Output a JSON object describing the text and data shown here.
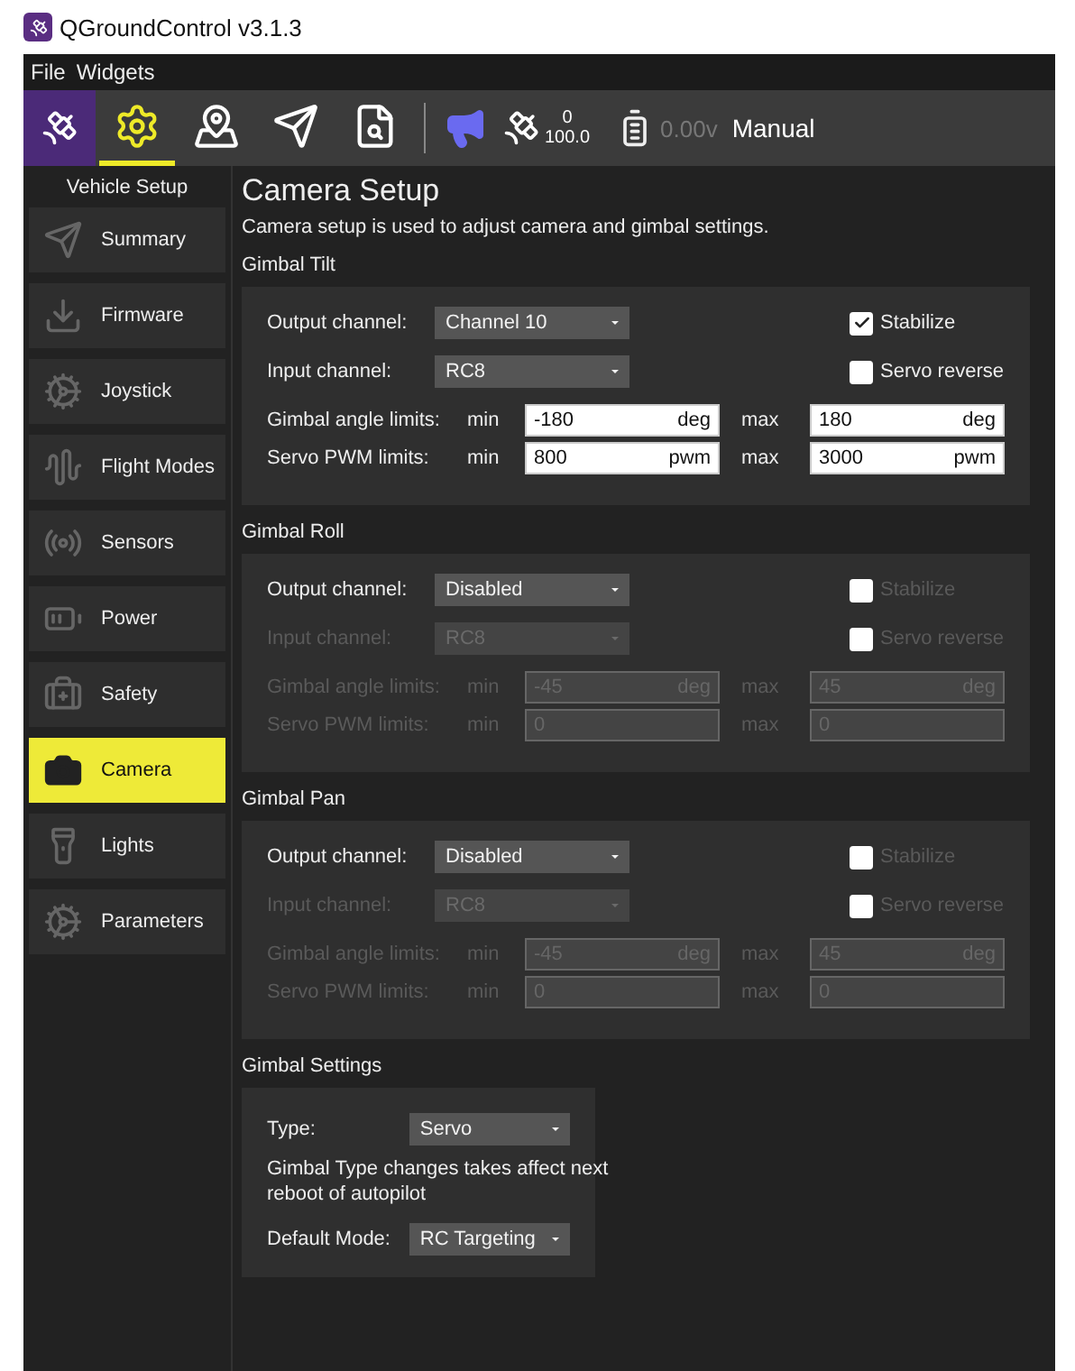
{
  "window": {
    "title": "QGroundControl v3.1.3"
  },
  "menu": [
    "File",
    "Widgets"
  ],
  "toolbar": {
    "views": [
      {
        "selected": true
      },
      {
        "selected": false
      },
      {
        "selected": false
      },
      {
        "selected": false
      }
    ],
    "satellites": "0",
    "hdop": "100.0",
    "battery": "0.00v",
    "flight_mode": "Manual"
  },
  "sidebar": {
    "title": "Vehicle Setup",
    "items": [
      {
        "label": "Summary",
        "selected": false
      },
      {
        "label": "Firmware",
        "selected": false
      },
      {
        "label": "Joystick",
        "selected": false
      },
      {
        "label": "Flight Modes",
        "selected": false
      },
      {
        "label": "Sensors",
        "selected": false
      },
      {
        "label": "Power",
        "selected": false
      },
      {
        "label": "Safety",
        "selected": false
      },
      {
        "label": "Camera",
        "selected": true
      },
      {
        "label": "Lights",
        "selected": false
      },
      {
        "label": "Parameters",
        "selected": false
      }
    ]
  },
  "page": {
    "title": "Camera Setup",
    "description": "Camera setup is used to adjust camera and gimbal settings.",
    "gimbals": [
      {
        "title": "Gimbal Tilt",
        "disabled": false,
        "output_label": "Output channel:",
        "output": "Channel 10",
        "input_label": "Input channel:",
        "input": "RC8",
        "stabilize": {
          "label": "Stabilize",
          "checked": true
        },
        "reverse": {
          "label": "Servo reverse",
          "checked": false
        },
        "limits": [
          {
            "label": "Gimbal angle limits:",
            "min_label": "min",
            "min": "-180",
            "min_unit": "deg",
            "max_label": "max",
            "max": "180",
            "max_unit": "deg"
          },
          {
            "label": "Servo PWM limits:",
            "min_label": "min",
            "min": "800",
            "min_unit": "pwm",
            "max_label": "max",
            "max": "3000",
            "max_unit": "pwm"
          }
        ]
      },
      {
        "title": "Gimbal Roll",
        "disabled": true,
        "output_label": "Output channel:",
        "output": "Disabled",
        "input_label": "Input channel:",
        "input": "RC8",
        "stabilize": {
          "label": "Stabilize",
          "checked": false
        },
        "reverse": {
          "label": "Servo reverse",
          "checked": false
        },
        "limits": [
          {
            "label": "Gimbal angle limits:",
            "min_label": "min",
            "min": "-45",
            "min_unit": "deg",
            "max_label": "max",
            "max": "45",
            "max_unit": "deg"
          },
          {
            "label": "Servo PWM limits:",
            "min_label": "min",
            "min": "0",
            "max_label": "max",
            "max": "0"
          }
        ]
      },
      {
        "title": "Gimbal Pan",
        "disabled": true,
        "output_label": "Output channel:",
        "output": "Disabled",
        "input_label": "Input channel:",
        "input": "RC8",
        "stabilize": {
          "label": "Stabilize",
          "checked": false
        },
        "reverse": {
          "label": "Servo reverse",
          "checked": false
        },
        "limits": [
          {
            "label": "Gimbal angle limits:",
            "min_label": "min",
            "min": "-45",
            "min_unit": "deg",
            "max_label": "max",
            "max": "45",
            "max_unit": "deg"
          },
          {
            "label": "Servo PWM limits:",
            "min_label": "min",
            "min": "0",
            "max_label": "max",
            "max": "0"
          }
        ]
      }
    ],
    "settings": {
      "title": "Gimbal Settings",
      "type_label": "Type:",
      "type": "Servo",
      "note": "Gimbal Type changes takes affect next reboot of autopilot",
      "mode_label": "Default Mode:",
      "mode": "RC Targeting"
    }
  }
}
